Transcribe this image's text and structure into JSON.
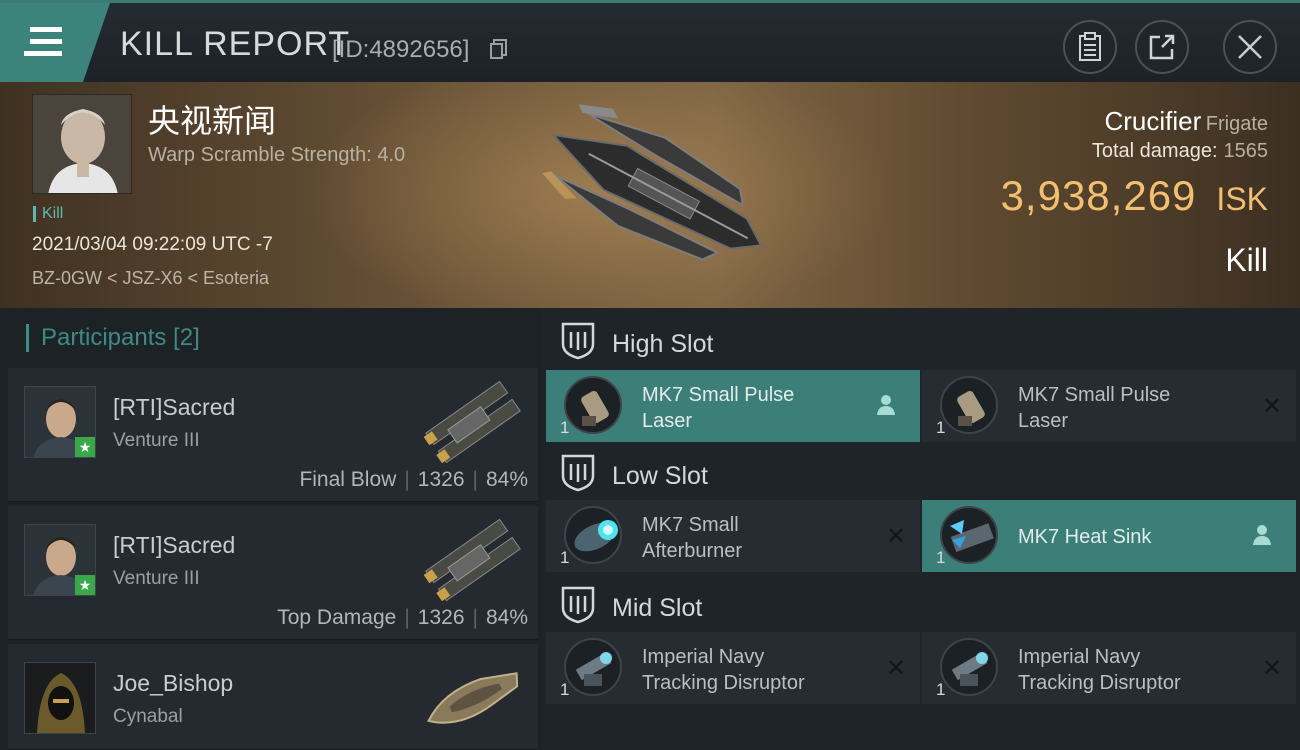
{
  "header": {
    "title": "KILL REPORT",
    "report_id": "[ID:4892656]"
  },
  "victim": {
    "name": "央视新闻",
    "warp_scramble": "Warp Scramble Strength: 4.0",
    "kill_tag": "Kill",
    "datetime": "2021/03/04 09:22:09 UTC -7",
    "location": "BZ-0GW < JSZ-X6 < Esoteria",
    "ship_name": "Crucifier",
    "ship_class": "Frigate",
    "damage_label": "Total damage:",
    "damage_value": "1565",
    "isk_value": "3,938,269",
    "isk_unit": "ISK",
    "result": "Kill"
  },
  "participants": {
    "title": "Participants [2]",
    "rows": [
      {
        "name": "[RTI]Sacred",
        "ship": "Venture III",
        "role": "Final Blow",
        "damage": "1326",
        "percent": "84%"
      },
      {
        "name": "[RTI]Sacred",
        "ship": "Venture III",
        "role": "Top Damage",
        "damage": "1326",
        "percent": "84%"
      },
      {
        "name": "Joe_Bishop",
        "ship": "Cynabal"
      }
    ]
  },
  "slots": {
    "high": {
      "title": "High Slot",
      "modules": [
        {
          "qty": "1",
          "name_line1": "MK7 Small Pulse",
          "name_line2": "Laser"
        },
        {
          "qty": "1",
          "name_line1": "MK7 Small Pulse",
          "name_line2": "Laser"
        }
      ]
    },
    "low": {
      "title": "Low Slot",
      "modules": [
        {
          "qty": "1",
          "name_line1": "MK7 Small",
          "name_line2": "Afterburner"
        },
        {
          "qty": "1",
          "name_line1": "MK7 Heat Sink"
        }
      ]
    },
    "mid": {
      "title": "Mid Slot",
      "modules": [
        {
          "qty": "1",
          "name_line1": "Imperial Navy",
          "name_line2": "Tracking Disruptor"
        },
        {
          "qty": "1",
          "name_line1": "Imperial Navy",
          "name_line2": "Tracking Disruptor"
        }
      ]
    }
  },
  "colors": {
    "accent_teal": "#3c7f78",
    "isk_gold": "#f2c070",
    "badge_green": "#3aa84a"
  },
  "icons": [
    "menu-icon",
    "copy-icon",
    "clipboard-icon",
    "share-icon",
    "close-icon",
    "slot-icon",
    "person-icon",
    "x-icon",
    "star-icon"
  ]
}
